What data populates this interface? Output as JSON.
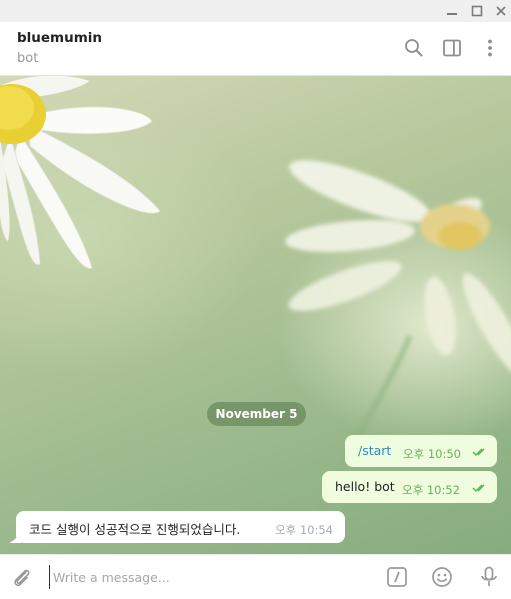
{
  "chat": {
    "title": "bluemumin",
    "subtitle": "bot"
  },
  "date_divider": "November 5",
  "messages": [
    {
      "direction": "outgoing",
      "text": "/start",
      "time": "오후 10:50",
      "read": true
    },
    {
      "direction": "outgoing",
      "text": "hello! bot",
      "time": "오후 10:52",
      "read": true
    },
    {
      "direction": "incoming",
      "text": "코드 실행이 성공적으로 진행되었습니다.",
      "time": "오후 10:54"
    }
  ],
  "composer": {
    "placeholder": "Write a message..."
  },
  "icons": {
    "window": [
      "minimize-icon",
      "maximize-icon",
      "close-icon"
    ],
    "header": [
      "search-icon",
      "sidebar-toggle-icon",
      "more-vertical-icon"
    ],
    "composer": [
      "attach-icon",
      "bot-commands-icon",
      "emoji-icon",
      "microphone-icon"
    ]
  },
  "colors": {
    "outgoing_bubble": "#effdde",
    "incoming_bubble": "#ffffff",
    "read_check": "#5fb35a",
    "command_link": "#2f8ac3"
  }
}
